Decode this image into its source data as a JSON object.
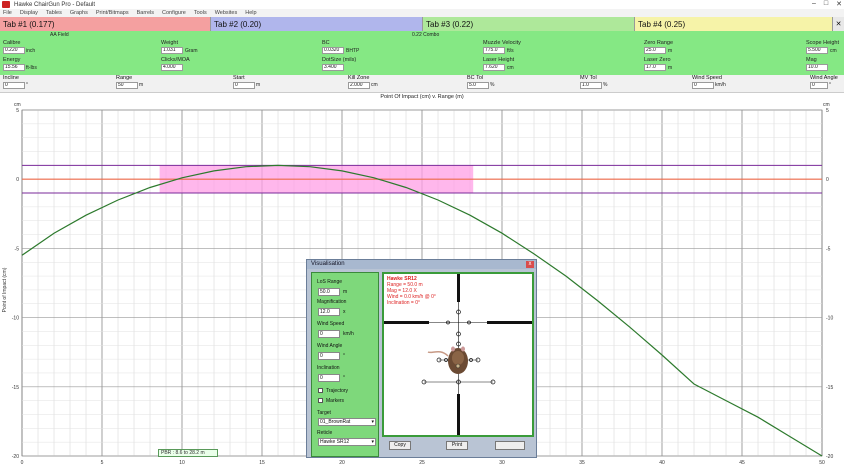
{
  "window": {
    "title": "Hawke ChairGun Pro - Default",
    "min": "–",
    "max": "□",
    "close": "✕"
  },
  "menu": [
    "File",
    "Display",
    "Tables",
    "Graphs",
    "Print/Bitmaps",
    "Barrels",
    "Configure",
    "Tools",
    "Websites",
    "Help"
  ],
  "tabs": [
    {
      "label": "Tab #1 (0.177)",
      "color": "#f4a0a0"
    },
    {
      "label": "Tab #2 (0.20)",
      "color": "#b0b6ec"
    },
    {
      "label": "Tab #3 (0.22)",
      "color": "#aee89a"
    },
    {
      "label": "Tab #4 (0.25)",
      "color": "#f6f3a8"
    }
  ],
  "tab_close": "✕",
  "headers": {
    "pellet": "AA Field",
    "combo": "0.22 Combo"
  },
  "fields": {
    "calibre": {
      "label": "Calibre",
      "value": "0.220",
      "unit": "inch"
    },
    "energy": {
      "label": "Energy",
      "value": "15.56",
      "unit": "ft-lbs"
    },
    "weight": {
      "label": "Weight",
      "value": "1.031",
      "unit": "Gram"
    },
    "clicks": {
      "label": "Clicks/MOA",
      "value": "4.000"
    },
    "bc": {
      "label": "BC",
      "value": "0.0320",
      "unit": "BHTP"
    },
    "dotsize": {
      "label": "DotSize (mils)",
      "value": "3.400"
    },
    "muzzle": {
      "label": "Muzzle Velocity",
      "value": "775.0",
      "unit": "ft/s"
    },
    "lowheight": {
      "label": "Laser Height",
      "value": "7.620",
      "unit": "cm"
    },
    "zerorange": {
      "label": "Zero Range",
      "value": "25.0",
      "unit": "m"
    },
    "laserzero": {
      "label": "Laser Zero",
      "value": "17.0",
      "unit": "m"
    },
    "scopeheight": {
      "label": "Scope Height",
      "value": "5.500",
      "unit": "cm"
    },
    "mag": {
      "label": "Mag",
      "value": "10.0"
    }
  },
  "row2": {
    "incline": {
      "label": "Incline",
      "value": "0",
      "unit": "°"
    },
    "range": {
      "label": "Range",
      "value": "50",
      "unit": "m"
    },
    "start": {
      "label": "Start",
      "value": "0",
      "unit": "m"
    },
    "killzone": {
      "label": "Kill Zone",
      "value": "2.000",
      "unit": "cm"
    },
    "bctol": {
      "label": "BC Tol",
      "value": "5.0",
      "unit": "%"
    },
    "mvtol": {
      "label": "MV Tol",
      "value": "1.0",
      "unit": "%"
    },
    "windspeed": {
      "label": "Wind Speed",
      "value": "0",
      "unit": "km/h"
    },
    "windangle": {
      "label": "Wind Angle",
      "value": "0",
      "unit": "°"
    }
  },
  "chart_data": {
    "type": "line",
    "title": "Point Of Impact (cm) v. Range (m)",
    "ylabel": "Point of Impact (cm)",
    "y_unit_left": "cm",
    "y_unit_right": "cm",
    "xlim": [
      0,
      50
    ],
    "ylim": [
      -20,
      5
    ],
    "x_ticks": [
      0,
      5,
      10,
      15,
      20,
      25,
      30,
      35,
      40,
      45,
      50
    ],
    "y_ticks": [
      5,
      0,
      -5,
      -10,
      -15,
      -20
    ],
    "kill_zone": {
      "x_range": [
        8.6,
        28.2
      ],
      "y_range": [
        -1,
        1
      ],
      "color": "#ff9fe6"
    },
    "series": [
      {
        "color": "#2d7a2d",
        "x": [
          0,
          2,
          4,
          6,
          8,
          10,
          12,
          14,
          16,
          18,
          20,
          22,
          24,
          26,
          28,
          30,
          32,
          34,
          36,
          38,
          40,
          42,
          44,
          46,
          48,
          50
        ],
        "y": [
          -5.5,
          -3.9,
          -2.6,
          -1.5,
          -0.6,
          0.1,
          0.6,
          0.9,
          1.0,
          0.9,
          0.6,
          0.1,
          -0.6,
          -1.5,
          -2.6,
          -3.9,
          -5.4,
          -7.0,
          -8.8,
          -10.7,
          -12.7,
          -14.8,
          -16.0,
          -17.2,
          -18.6,
          -20.0
        ]
      }
    ]
  },
  "status_text": "PBR : 8.6 to 28.2 m",
  "vis": {
    "title": "Visualisation",
    "close": "x",
    "lof_range_label": "LoS Range",
    "lof_range": "50.0",
    "lof_range_unit": "m",
    "magnification_label": "Magnification",
    "magnification": "12.0",
    "magnification_unit": "x",
    "windspeed_label": "Wind Speed",
    "windspeed": "0",
    "windspeed_unit": "km/h",
    "windangle_label": "Wind Angle",
    "windangle": "0",
    "windangle_unit": "°",
    "incline_label": "Inclination",
    "incline": "0",
    "incline_unit": "°",
    "trajectory": "Trajectory",
    "markers": "Markers",
    "target_label": "Target",
    "target": "01_BrownRat",
    "reticle_label": "Reticle",
    "reticle": "Hawke SR12",
    "info": [
      "Hawke SR12",
      "Range = 50.0 m",
      "Mag = 12.0 X",
      "Wind = 0.0 km/h @ 0°",
      "Inclination = 0°"
    ],
    "copy": "Copy",
    "print": "Print"
  }
}
